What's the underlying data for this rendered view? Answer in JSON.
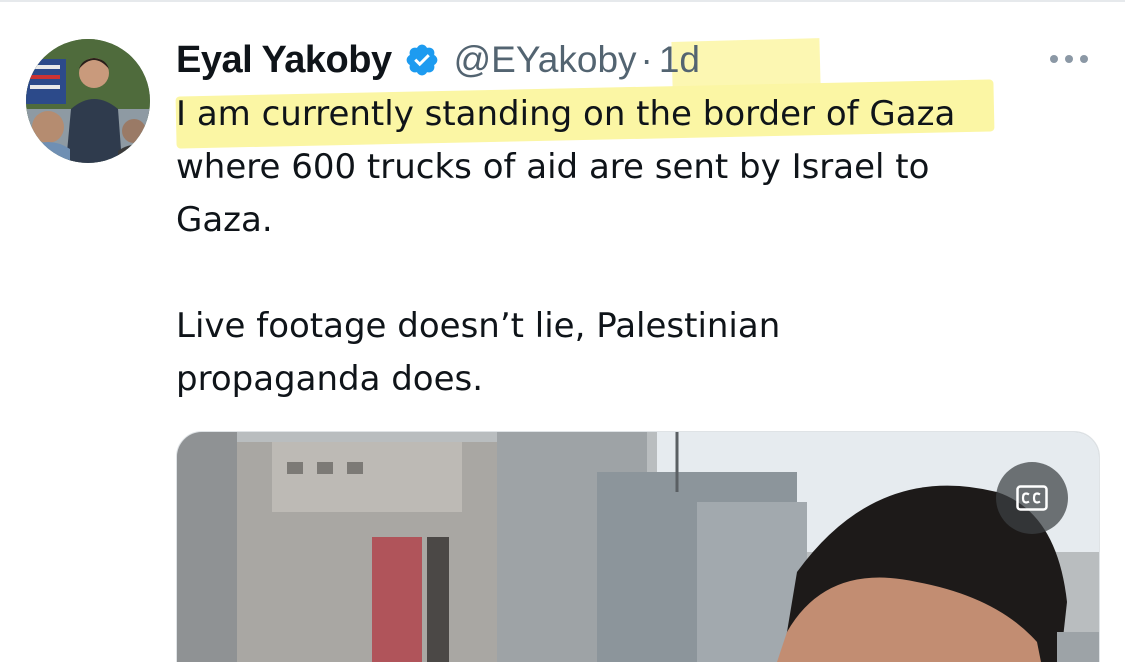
{
  "tweet": {
    "author": {
      "display_name": "Eyal Yakoby",
      "handle": "@EYakoby",
      "verified": true,
      "avatar_icon": "profile-photo"
    },
    "separator": "·",
    "timestamp": "1d",
    "more_icon": "more-dots-icon",
    "text_lines": [
      "I am currently standing on the border of Gaza",
      "where 600 trucks of aid are sent by Israel to",
      "Gaza.",
      "Live footage doesn’t lie, Palestinian",
      "propaganda does."
    ],
    "media": {
      "type": "video",
      "captions_icon": "closed-captions-icon"
    }
  },
  "colors": {
    "text_primary": "#0f1419",
    "text_secondary": "#536471",
    "verified_blue": "#1d9bf0",
    "highlight": "#fbf6a4"
  }
}
